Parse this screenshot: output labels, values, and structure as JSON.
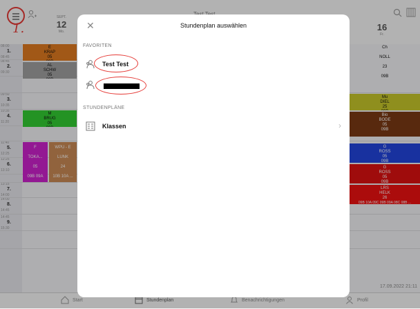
{
  "topbar": {
    "annotation": "1.",
    "title": "Test Test",
    "day_left": {
      "month": "SEPT.",
      "num": "12",
      "wd": "Mo."
    },
    "day_right": {
      "num": "16",
      "wd": "Fr."
    }
  },
  "times": [
    {
      "start": "08:00",
      "n": "1.",
      "end": "08:45"
    },
    {
      "start": "08:45",
      "n": "2.",
      "end": "09:30"
    },
    {
      "start": "09:50",
      "n": "3.",
      "end": "10:35"
    },
    {
      "start": "10:35",
      "n": "4.",
      "end": "11:20"
    },
    {
      "start": "11:40",
      "n": "5.",
      "end": "12:25"
    },
    {
      "start": "12:25",
      "n": "6.",
      "end": "13:10"
    },
    {
      "start": "13:15",
      "n": "7.",
      "end": "14:00"
    },
    {
      "start": "14:00",
      "n": "8.",
      "end": "14:45"
    },
    {
      "start": "14:45",
      "n": "9.",
      "end": "15:30"
    }
  ],
  "left_cells": [
    {
      "l1": "E",
      "l2": "KRAP",
      "l3": "05",
      "l4": "09B",
      "color": "#e07b20"
    },
    {
      "l1": "AL",
      "l2": "SCHW",
      "l3": "05",
      "l4": "09B",
      "color": "#a0a0a0"
    },
    {
      "l1": "M",
      "l2": "BRUG",
      "l3": "05",
      "l4": "09B",
      "color": "#33cc33"
    },
    {
      "l1": "F",
      "l2": "TOKA...",
      "l3": "05",
      "l4": "09B 09A",
      "color": "#cc22cc"
    },
    {
      "l1": "WPU - E",
      "l2": "LUNK",
      "l3": "24",
      "l4": "10B 10A ...",
      "color": "#c98a55"
    }
  ],
  "right_cells": [
    {
      "l1": "Ch",
      "color": "#f2f2f4"
    },
    {
      "l1": "NOLL",
      "color": "#f2f2f4"
    },
    {
      "l1": "23",
      "color": "#f2f2f4"
    },
    {
      "l1": "09B",
      "color": "#f2f2f4"
    },
    {
      "l1": "Mu",
      "l2": "DIEL",
      "l3": "25",
      "l4": "09B",
      "color": "#c6c62a"
    },
    {
      "l1": "Bio",
      "l2": "BODE",
      "l3": "05",
      "l4": "09B",
      "color": "#7a3a14"
    },
    {
      "l1": "G",
      "l2": "ROSS",
      "l3": "05",
      "l4": "09B",
      "color": "#2244dd"
    },
    {
      "l1": "G",
      "l2": "ROSS",
      "l3": "05",
      "l4": "09B",
      "color": "#dd1111"
    },
    {
      "l1": "LRS",
      "l2": "HELK",
      "l3": "26",
      "l4": "09B 10A 09C 09B 09A 08C 08B ...",
      "color": "#ee1111"
    }
  ],
  "modal": {
    "title": "Stundenplan auswählen",
    "section_favorites": "FAVORITEN",
    "favorite_1": "Test Test",
    "section_plans": "STUNDENPLÄNE",
    "plans_item": "Klassen"
  },
  "timestamp": "17.09.2022 21:11",
  "tabs": [
    {
      "label": "Start"
    },
    {
      "label": "Stundenplan"
    },
    {
      "label": "Benachrichtigungen"
    },
    {
      "label": "Profil"
    }
  ],
  "colors": {
    "annotation": "#e53935",
    "overlay": "rgba(0,0,0,0.28)"
  }
}
